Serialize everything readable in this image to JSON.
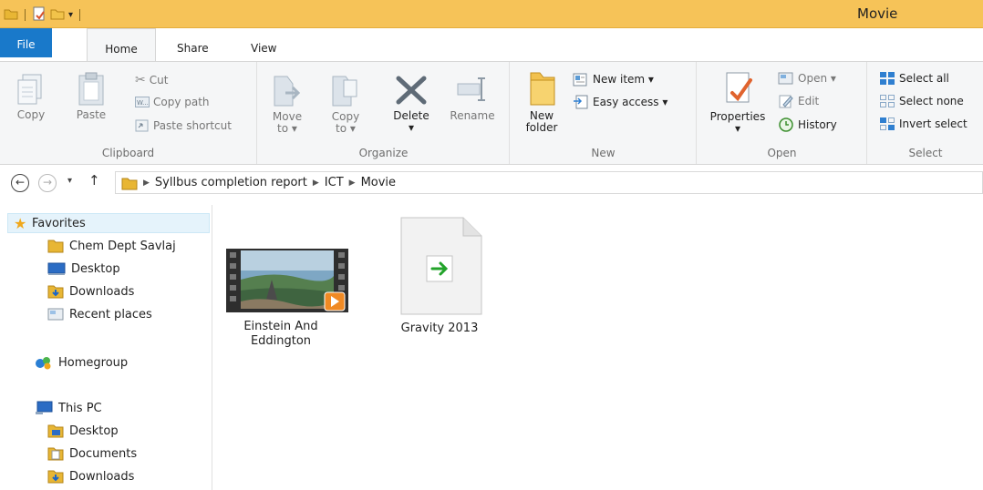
{
  "window": {
    "title": "Movie"
  },
  "tabs": {
    "file": "File",
    "home": "Home",
    "share": "Share",
    "view": "View"
  },
  "ribbon": {
    "clipboard": {
      "label": "Clipboard",
      "copy": "Copy",
      "paste": "Paste",
      "cut": "Cut",
      "copy_path": "Copy path",
      "paste_shortcut": "Paste shortcut"
    },
    "organize": {
      "label": "Organize",
      "move_to_1": "Move",
      "move_to_2": "to ▾",
      "copy_to_1": "Copy",
      "copy_to_2": "to ▾",
      "delete": "Delete",
      "delete_arrow": "▾",
      "rename": "Rename"
    },
    "new": {
      "label": "New",
      "new_folder_1": "New",
      "new_folder_2": "folder",
      "new_item": "New item ▾",
      "easy_access": "Easy access ▾"
    },
    "open": {
      "label": "Open",
      "properties": "Properties",
      "properties_arrow": "▾",
      "open": "Open ▾",
      "edit": "Edit",
      "history": "History"
    },
    "select": {
      "label": "Select",
      "select_all": "Select all",
      "select_none": "Select none",
      "invert": "Invert select"
    }
  },
  "address": {
    "crumbs": [
      "Syllbus completion report",
      "ICT",
      "Movie"
    ]
  },
  "nav": {
    "favorites": "Favorites",
    "fav_items": [
      "Chem Dept Savlaj",
      "Desktop",
      "Downloads",
      "Recent places"
    ],
    "homegroup": "Homegroup",
    "this_pc": "This PC",
    "pc_items": [
      "Desktop",
      "Documents",
      "Downloads"
    ]
  },
  "files": [
    {
      "name_1": "Einstein And",
      "name_2": "Eddington",
      "type": "video"
    },
    {
      "name_1": "Gravity 2013",
      "type": "shortcut"
    }
  ]
}
